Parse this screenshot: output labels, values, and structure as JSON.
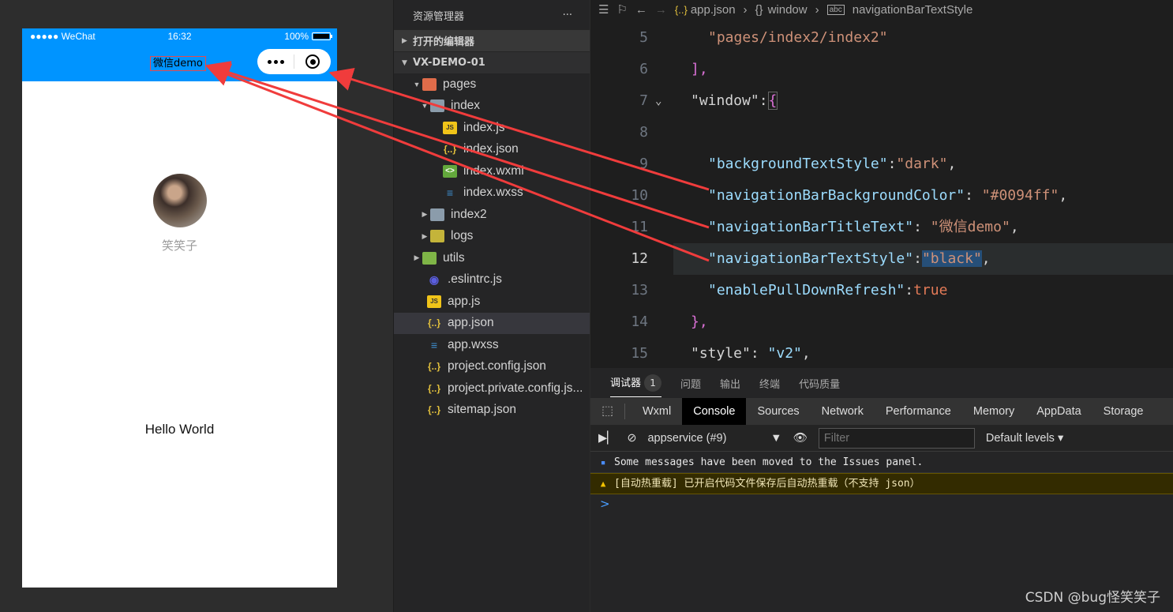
{
  "simulator": {
    "status_carrier": "●●●●● WeChat",
    "status_time": "16:32",
    "status_battery": "100%",
    "nav_title": "微信demo",
    "nickname": "笑笑子",
    "body_text": "Hello World"
  },
  "explorer": {
    "title": "资源管理器",
    "more": "···",
    "open_editors": "打开的编辑器",
    "project": "VX-DEMO-01",
    "tree": [
      {
        "label": "pages",
        "icon": "folder-orange-icon"
      },
      {
        "label": "index",
        "icon": "folder-gray-icon"
      },
      {
        "label": "index.js",
        "icon": "js-file-icon"
      },
      {
        "label": "index.json",
        "icon": "json-file-icon"
      },
      {
        "label": "index.wxml",
        "icon": "wxml-file-icon"
      },
      {
        "label": "index.wxss",
        "icon": "wxss-file-icon"
      },
      {
        "label": "index2",
        "icon": "folder-gray-icon"
      },
      {
        "label": "logs",
        "icon": "folder-yellow-icon"
      },
      {
        "label": "utils",
        "icon": "folder-green-icon"
      },
      {
        "label": ".eslintrc.js",
        "icon": "eslint-file-icon"
      },
      {
        "label": "app.js",
        "icon": "js-file-icon"
      },
      {
        "label": "app.json",
        "icon": "json-file-icon"
      },
      {
        "label": "app.wxss",
        "icon": "wxss-file-icon"
      },
      {
        "label": "project.config.json",
        "icon": "json-file-icon"
      },
      {
        "label": "project.private.config.js...",
        "icon": "json-file-icon"
      },
      {
        "label": "sitemap.json",
        "icon": "json-file-icon"
      }
    ]
  },
  "editor": {
    "breadcrumb": [
      "app.json",
      "window",
      "navigationBarTextStyle"
    ],
    "breadcrumb_icons": [
      "{..}",
      "{}",
      "abc"
    ],
    "line_numbers": [
      "5",
      "6",
      "7",
      "8",
      "9",
      "10",
      "11",
      "12",
      "13",
      "14",
      "15"
    ],
    "current_line": "12",
    "code": {
      "l5": "\"pages/index2/index2\"",
      "l6": "],",
      "l7_key": "\"window\"",
      "l9_key": "\"backgroundTextStyle\"",
      "l9_val": "\"dark\"",
      "l10_key": "\"navigationBarBackgroundColor\"",
      "l10_val": "\"#0094ff\"",
      "l11_key": "\"navigationBarTitleText\"",
      "l11_val": "\"微信demo\"",
      "l12_key": "\"navigationBarTextStyle\"",
      "l12_val": "\"black\"",
      "l13_key": "\"enablePullDownRefresh\"",
      "l13_val": "true",
      "l14": "},",
      "l15_key": "\"style\"",
      "l15_val": "\"v2\""
    }
  },
  "devtools": {
    "tabs": [
      "调试器",
      "问题",
      "输出",
      "终端",
      "代码质量"
    ],
    "badge": "1",
    "panel_tabs": [
      "Wxml",
      "Console",
      "Sources",
      "Network",
      "Performance",
      "Memory",
      "AppData",
      "Storage"
    ],
    "context": "appservice (#9)",
    "filter_placeholder": "Filter",
    "levels": "Default levels",
    "messages": {
      "info": "Some messages have been moved to the Issues panel.",
      "warn": "[自动热重载] 已开启代码文件保存后自动热重载（不支持 json）"
    },
    "prompt": ">"
  },
  "watermark": "CSDN @bug怪笑笑子",
  "colors": {
    "nav_bg": "#0094ff",
    "arrow": "#f03c3c"
  }
}
